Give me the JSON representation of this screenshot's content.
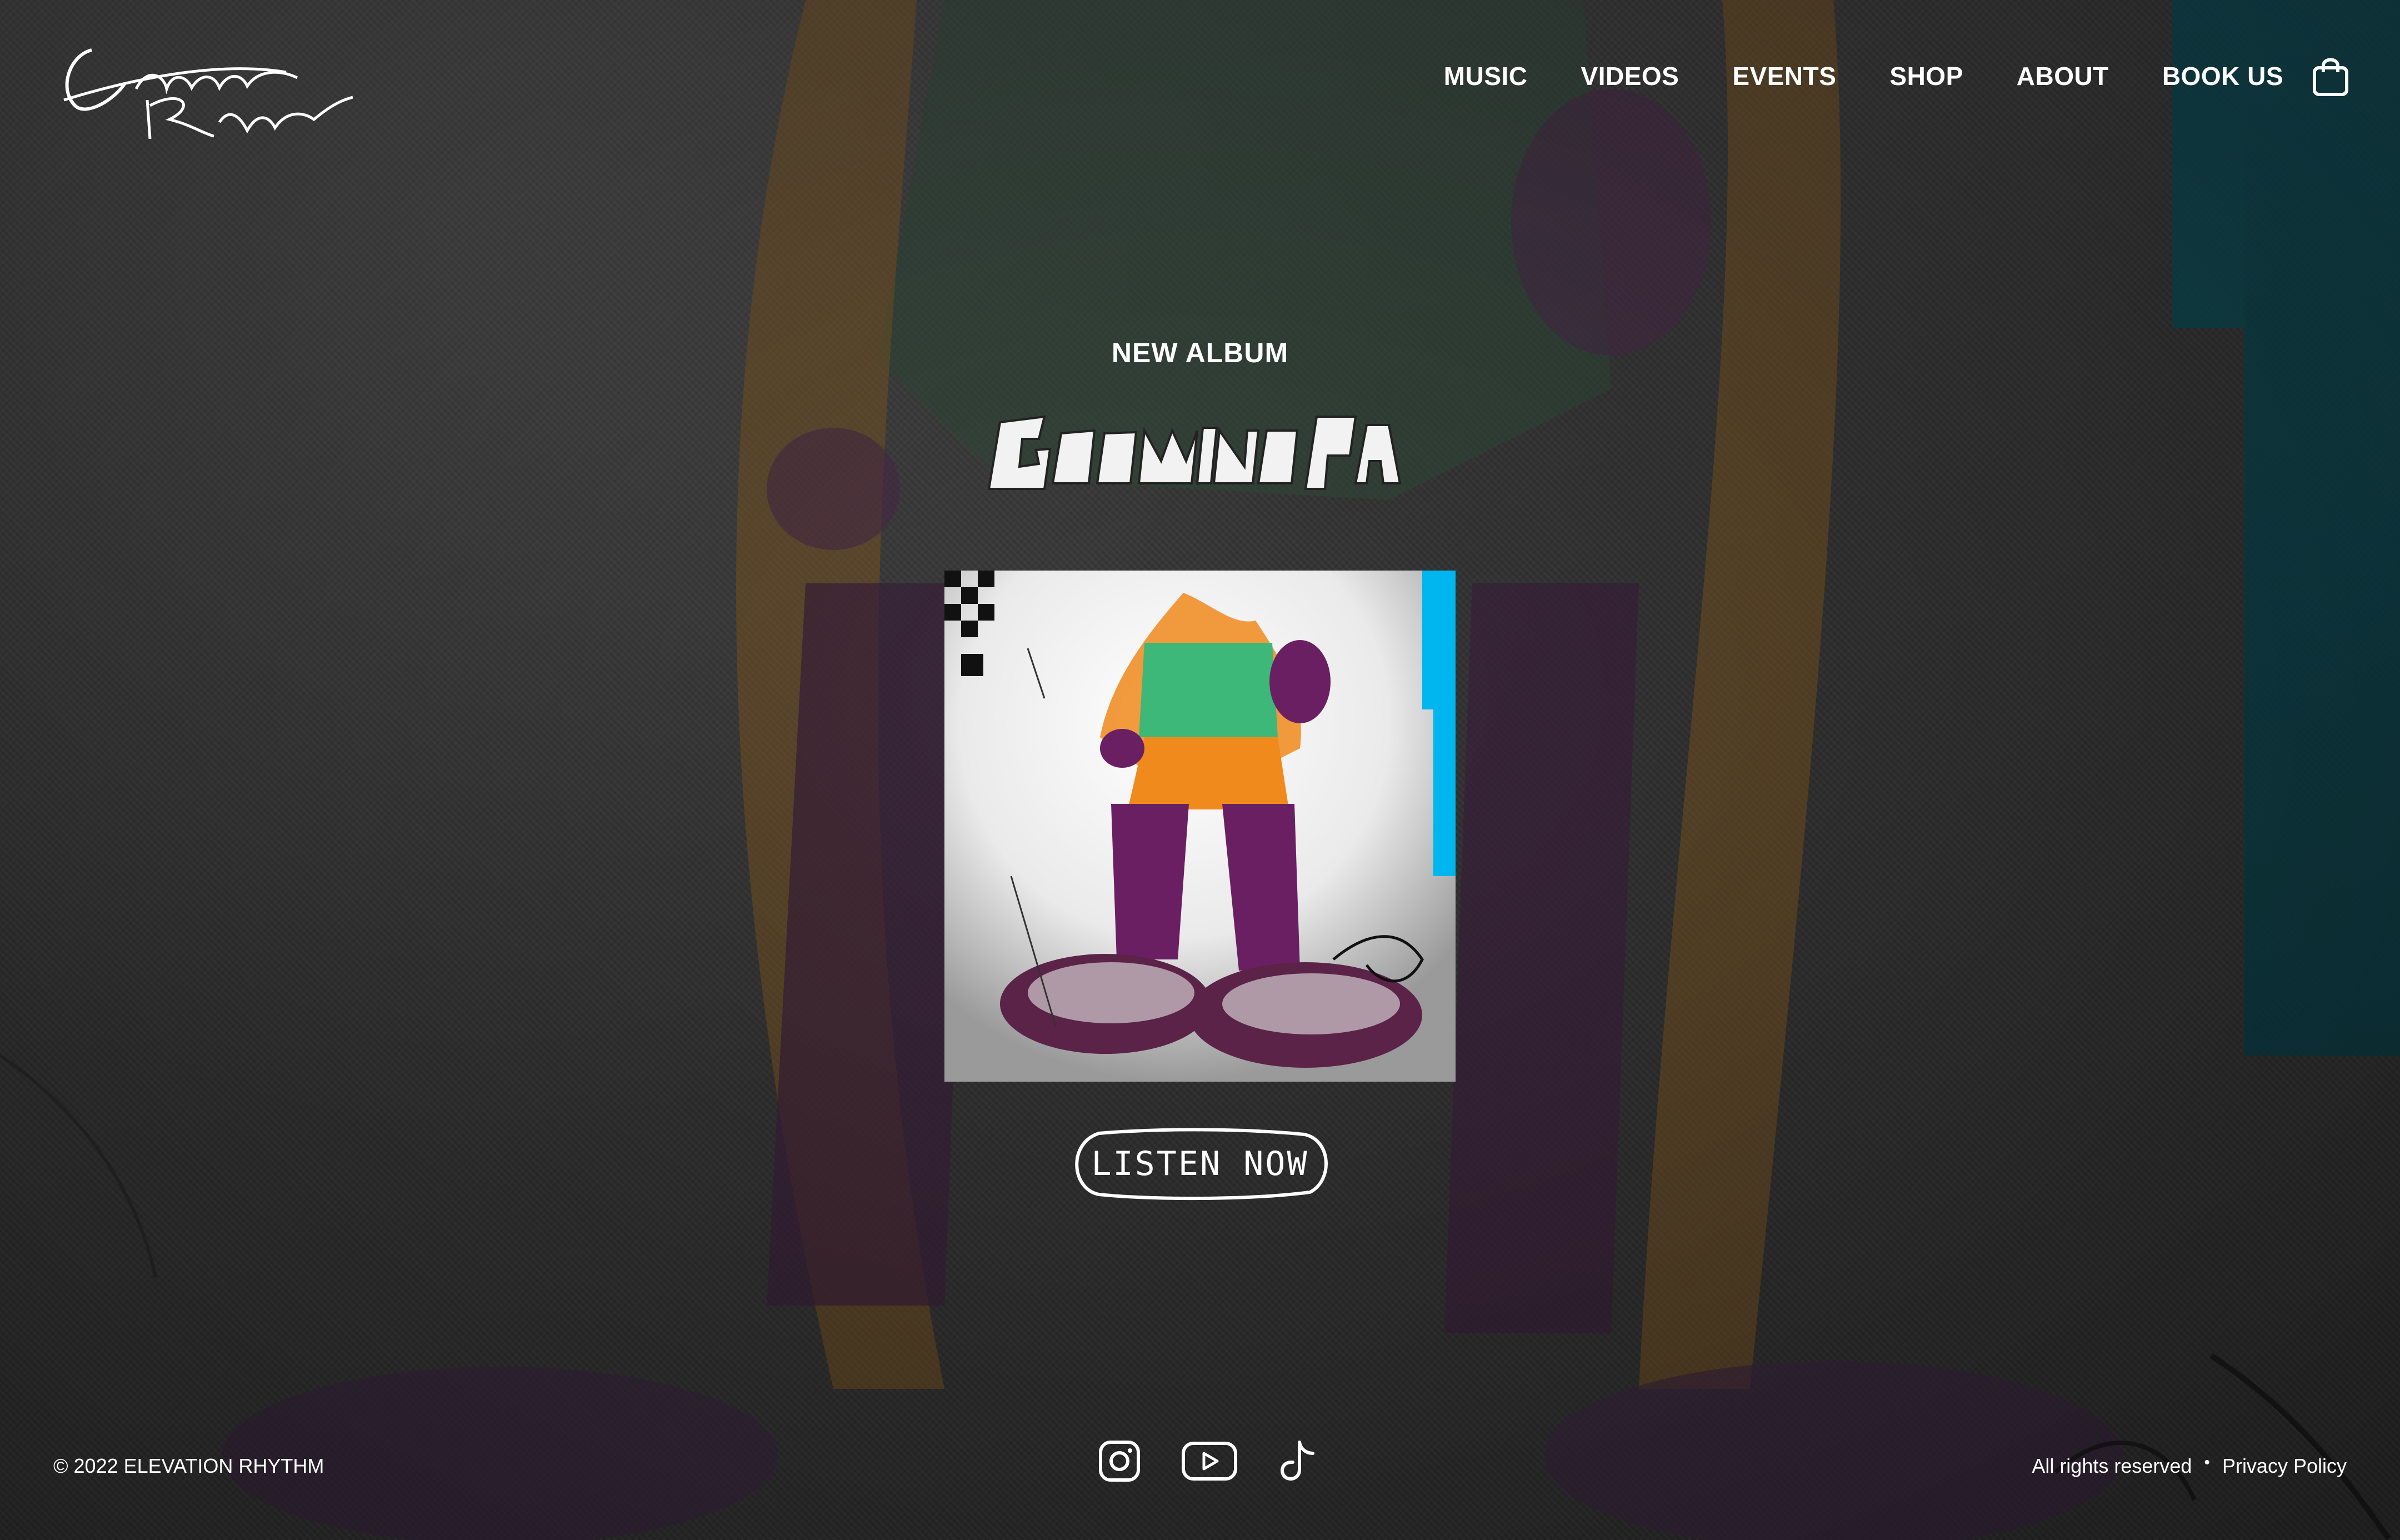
{
  "brand": {
    "logo_text_line1": "Elevation",
    "logo_text_line2": "Rhythm"
  },
  "nav": {
    "items": [
      {
        "label": "MUSIC"
      },
      {
        "label": "VIDEOS"
      },
      {
        "label": "EVENTS"
      },
      {
        "label": "SHOP"
      },
      {
        "label": "ABOUT"
      },
      {
        "label": "BOOK US"
      }
    ],
    "cart_icon": "shopping-bag-icon"
  },
  "hero": {
    "eyebrow": "NEW ALBUM",
    "album_title": "GROWING PAINS",
    "cta_label": "LISTEN NOW"
  },
  "footer": {
    "copyright": "© 2022 ELEVATION RHYTHM",
    "socials": [
      {
        "icon": "instagram-icon"
      },
      {
        "icon": "youtube-icon"
      },
      {
        "icon": "tiktok-icon"
      }
    ],
    "rights": "All rights reserved",
    "separator": "•",
    "privacy": "Privacy Policy"
  },
  "colors": {
    "background": "#3a3a3a",
    "teal_accent": "#0d4b55",
    "cyan_stripe": "#00b6ee",
    "orange": "#f08a1c",
    "purple": "#6b1f63",
    "green": "#3db878"
  }
}
